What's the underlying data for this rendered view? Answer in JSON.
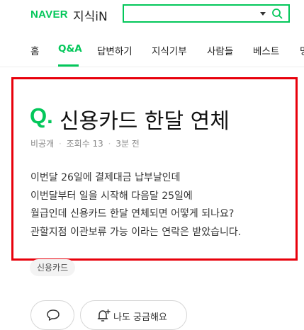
{
  "header": {
    "logo_brand": "NAVER",
    "logo_service": "지식iN",
    "search": {
      "value": ""
    }
  },
  "tabs": [
    {
      "label": "홈",
      "active": false
    },
    {
      "label": "Q&A",
      "active": true
    },
    {
      "label": "답변하기",
      "active": false
    },
    {
      "label": "지식기부",
      "active": false
    },
    {
      "label": "사람들",
      "active": false
    },
    {
      "label": "베스트",
      "active": false
    },
    {
      "label": "명",
      "active": false
    }
  ],
  "question": {
    "q_mark": "Q.",
    "title": "신용카드 한달 연체",
    "visibility": "비공개",
    "views_label": "조회수 13",
    "time": "3분 전",
    "body_lines": [
      "이번달 26일에 결제대금 납부날인데",
      "이번달부터 일을 시작해 다음달 25일에",
      "월급인데 신용카드 한달 연체되면 어떻게 되나요?",
      "관할지점 이관보류 가능 이라는 연락은 받았습니다."
    ],
    "tag": "신용카드"
  },
  "actions": {
    "curious_label": "나도 궁금해요"
  },
  "colors": {
    "brand_green": "#03c75a",
    "highlight_red": "#e8000b"
  }
}
